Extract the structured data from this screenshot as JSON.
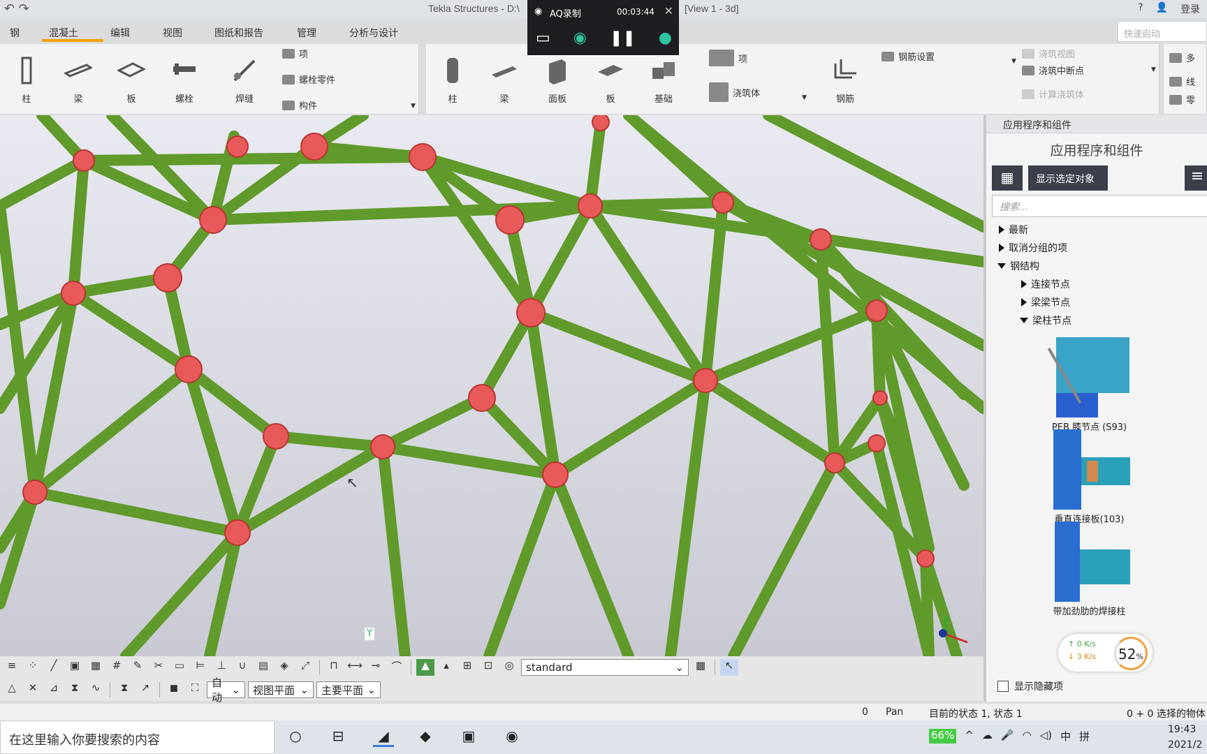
{
  "titlebar": {
    "title_left": "Tekla Structures - D:\\",
    "title_right": "[View 1 - 3d]",
    "help": "?",
    "login": "登录"
  },
  "menu": {
    "tabs": [
      "钢",
      "混凝土",
      "编辑",
      "视图",
      "图纸和报告",
      "管理",
      "分析与设计"
    ],
    "quick_start_placeholder": "快速启动"
  },
  "recorder": {
    "name": "AQ录制",
    "time": "00:03:44"
  },
  "ribbon_steel": {
    "column": "柱",
    "beam": "梁",
    "plate": "板",
    "bolt": "螺栓",
    "weld": "焊缝",
    "item": "项",
    "bolt_part": "螺栓零件",
    "component": "构件"
  },
  "ribbon_concrete": {
    "column": "柱",
    "beam": "梁",
    "panel": "面板",
    "slab": "板",
    "footing": "基础",
    "item": "项",
    "pour": "浇筑体",
    "rebar": "钢筋",
    "rebar_settings": "钢筋设置",
    "pour_view": "浇筑视图",
    "pour_break": "浇筑中断点",
    "calc_pour": "计算浇筑体",
    "more1": "多",
    "more2": "线",
    "more3": "零"
  },
  "viewport": {
    "y_axis": "Y"
  },
  "panel": {
    "header": "应用程序和组件",
    "big_title": "应用程序和组件",
    "show_selected": "显示选定对象",
    "search_placeholder": "搜索...",
    "tree": {
      "recent": "最新",
      "ungrouped": "取消分组的项",
      "steel": "钢结构",
      "connections": "连接节点",
      "beam_beam": "梁梁节点",
      "beam_column": "梁柱节点"
    },
    "thumbs": [
      "PEB 膝节点 (S93)",
      "垂直连接板(103)",
      "带加劲肋的焊接柱"
    ],
    "show_hidden": "显示隐藏项"
  },
  "speed": {
    "up": "0  K/s",
    "down": "3  K/s",
    "cpu": "52",
    "unit": "%"
  },
  "toolbar": {
    "filter": "standard",
    "snap1": "自动",
    "snap2": "视图平面",
    "snap3": "主要平面"
  },
  "status": {
    "zero": "0",
    "mode": "Pan",
    "state": "目前的状态 1, 状态 1",
    "selected": "0 + 0 选择的物体"
  },
  "taskbar": {
    "search": "在这里输入你要搜索的内容",
    "battery": "66%",
    "ime1": "中",
    "ime2": "拼",
    "time": "19:43",
    "date": "2021/2"
  }
}
